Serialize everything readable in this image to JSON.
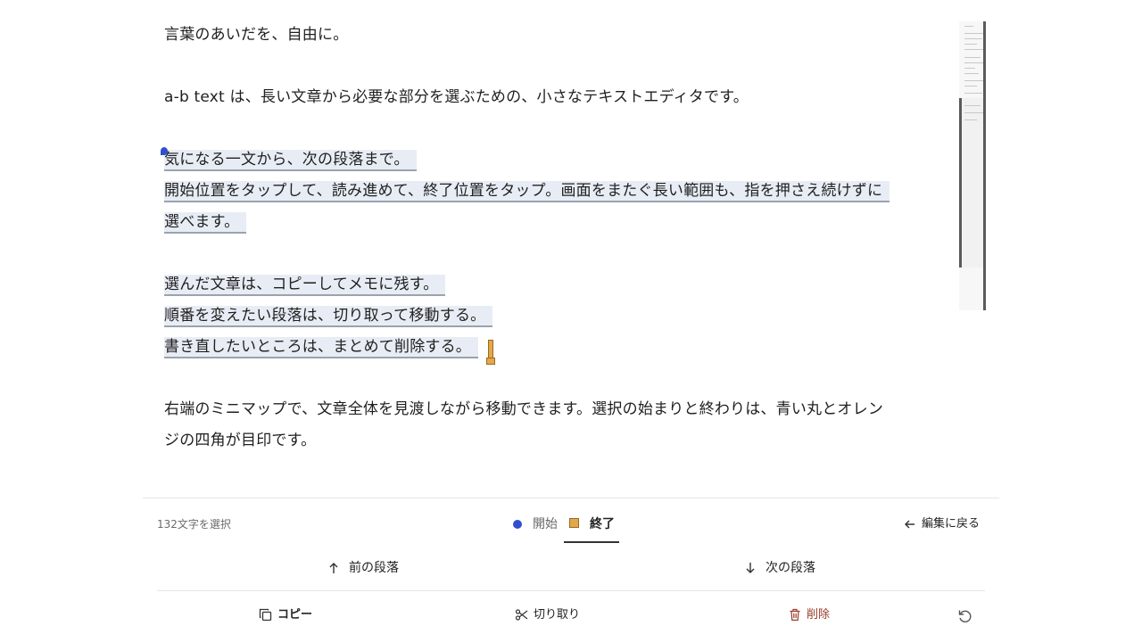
{
  "editor": {
    "heading": "言葉のあいだを、自由に。",
    "intro": "a-b text は、長い文章から必要な部分を選ぶための、小さなテキストエディタです。",
    "sel_line_1": "気になる一文から、次の段落まで。",
    "sel_line_2": "開始位置をタップして、読み進めて、終了位置をタップ。画面をまたぐ長い範囲も、指を押さえ続けずに",
    "sel_line_3": "選べます。",
    "sel_line_4": "選んだ文章は、コピーしてメモに残す。",
    "sel_line_5": "順番を変えたい段落は、切り取って移動する。",
    "sel_line_6": "書き直したいところは、まとめて削除する。",
    "outro_1": "右端のミニマップで、文章全体を見渡しながら移動できます。選択の始まりと終わりは、青い丸とオレン",
    "outro_2": "ジの四角が目印です。"
  },
  "status": {
    "selected_count": "132文字を選択"
  },
  "tabs": {
    "start_label": "開始",
    "end_label": "終了",
    "active": "終了"
  },
  "toolbar": {
    "back_label": "編集に戻る",
    "prev_paragraph": "前の段落",
    "next_paragraph": "次の段落",
    "copy_label": "コピー",
    "cut_label": "切り取り",
    "delete_label": "削除"
  },
  "colors": {
    "start_marker": "#2f4fd0",
    "end_marker": "#e3a74d",
    "delete_text": "#9a3a2a"
  },
  "icons": {
    "back": "arrow-left-icon",
    "prev": "arrow-up-icon",
    "next": "arrow-down-icon",
    "copy": "copy-icon",
    "cut": "scissors-icon",
    "delete": "trash-icon",
    "undo": "undo-icon"
  }
}
